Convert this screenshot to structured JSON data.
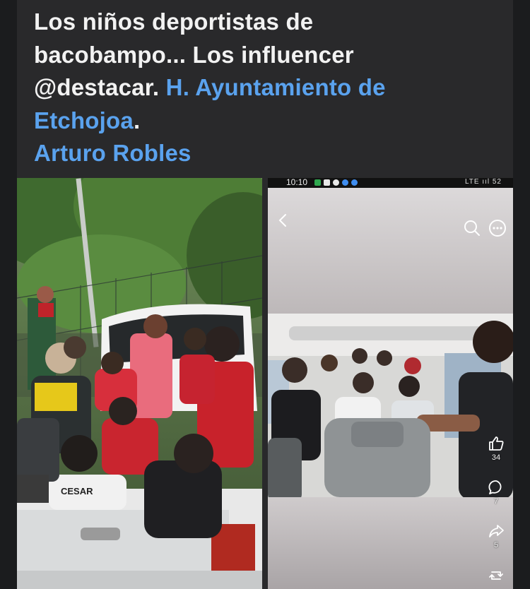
{
  "post": {
    "line1": "Los niños deportistas de",
    "line2": "bacobampo... Los influencer",
    "line3_text": "@destacar. ",
    "line3_link": "H. Ayuntamiento de",
    "line4_link": "Etchojoa",
    "line4_text": ".",
    "line5_link": "Arturo Robles"
  },
  "phone_screenshot": {
    "status_time": "10:10",
    "status_right": "LTE ııl 52"
  },
  "reel_actions": {
    "likes": "34",
    "comments": "7",
    "shares": "5"
  },
  "colors": {
    "background": "#1b1c1e",
    "card": "#29292b",
    "text": "#f2f2f2",
    "link": "#5aa2ee"
  }
}
